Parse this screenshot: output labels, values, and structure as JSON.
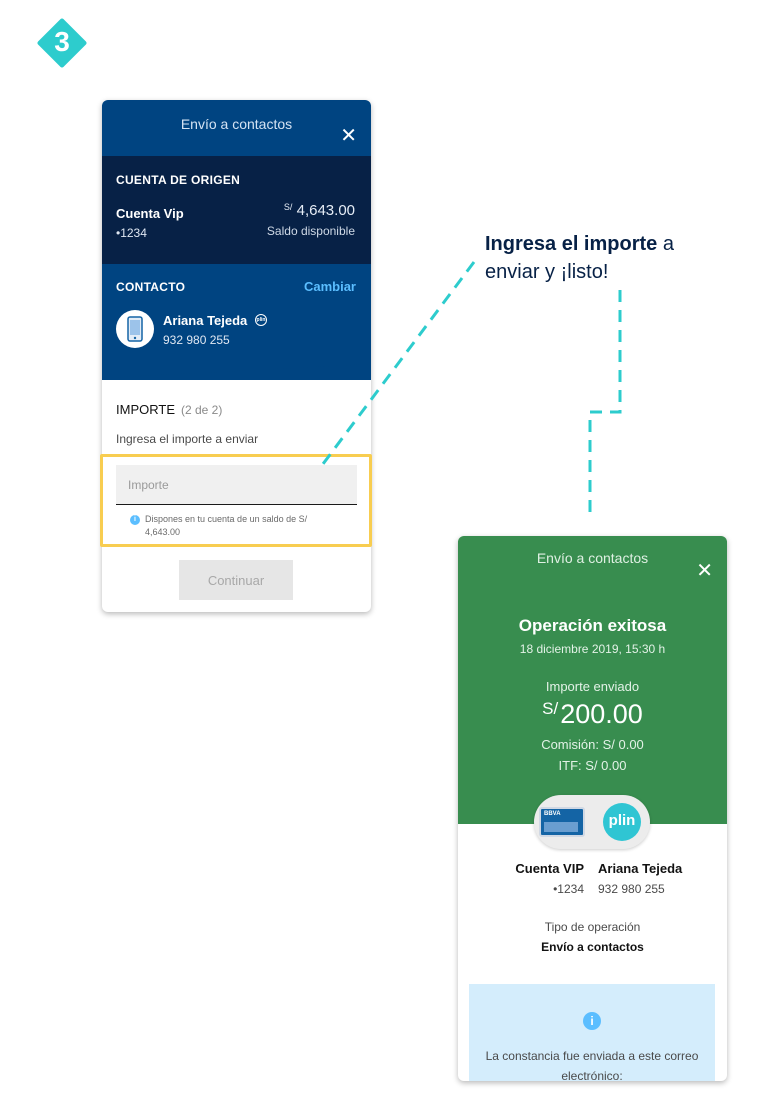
{
  "step_badge": {
    "number": "3",
    "color": "#2dcccd"
  },
  "screen1": {
    "title": "Envío a contactos",
    "close_icon": "close-icon",
    "origin": {
      "label": "CUENTA DE ORIGEN",
      "account_name": "Cuenta Vip",
      "account_number": "•1234",
      "currency": "S/",
      "balance": "4,643.00",
      "balance_label": "Saldo disponible"
    },
    "contact": {
      "label": "CONTACTO",
      "change_label": "Cambiar",
      "name": "Ariana Tejeda",
      "phone": "932 980 255",
      "avatar_icon": "phone-icon",
      "badge_icon": "plin-icon"
    },
    "amount": {
      "label": "IMPORTE",
      "step": "(2 de 2)",
      "hint": "Ingresa el importe a enviar",
      "placeholder": "Importe",
      "info_text": "Dispones en tu cuenta de un saldo de S/ 4,643.00"
    },
    "continue_label": "Continuar"
  },
  "callout": {
    "bold": "Ingresa el importe",
    "rest": " a enviar y ¡listo!"
  },
  "screen2": {
    "title": "Envío a contactos",
    "close_icon": "close-icon",
    "success_title": "Operación exitosa",
    "date": "18 diciembre 2019, 15:30 h",
    "sent_label": "Importe enviado",
    "currency": "S/",
    "sent_amount": "200.00",
    "fee": "Comisión: S/ 0.00",
    "itf": "ITF: S/ 0.00",
    "card_brand": "BBVA",
    "plin_label": "plin",
    "from_name": "Cuenta VIP",
    "from_number": "•1234",
    "to_name": "Ariana Tejeda",
    "to_phone": "932 980 255",
    "optype_label": "Tipo de operación",
    "optype_value": "Envío a contactos",
    "notice_text": "La constancia fue enviada a este correo electrónico:"
  },
  "colors": {
    "navy": "#072146",
    "blue": "#004481",
    "accent": "#5bbeff",
    "success_green": "#388d4f",
    "highlight": "#f8cd50",
    "plin": "#2fc5d3"
  }
}
